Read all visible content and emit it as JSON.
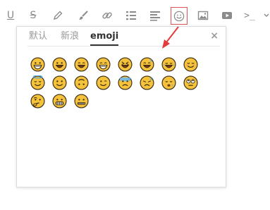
{
  "toolbar": {
    "buttons": [
      {
        "name": "underline",
        "icon": "underline-icon"
      },
      {
        "name": "strikethrough",
        "icon": "strikethrough-icon"
      },
      {
        "name": "pencil",
        "icon": "pencil-icon"
      },
      {
        "name": "brush",
        "icon": "brush-icon"
      },
      {
        "name": "link",
        "icon": "link-icon"
      },
      {
        "name": "list",
        "icon": "bullet-list-icon"
      },
      {
        "name": "align",
        "icon": "align-left-icon"
      },
      {
        "name": "emoji",
        "icon": "smiley-icon",
        "active": true
      },
      {
        "name": "image",
        "icon": "image-icon"
      },
      {
        "name": "video",
        "icon": "video-icon"
      },
      {
        "name": "code",
        "icon": "code-icon"
      },
      {
        "name": "more",
        "icon": "more-icon"
      }
    ],
    "underline_glyph": "U",
    "strike_glyph": "S",
    "code_glyph": ">_"
  },
  "emoji_panel": {
    "tabs": [
      {
        "label": "默认",
        "active": false
      },
      {
        "label": "新浪",
        "active": false
      },
      {
        "label": "emoji",
        "active": true
      }
    ],
    "close_glyph": "×",
    "emojis": [
      "grin",
      "smiley",
      "smile",
      "grinning",
      "laughing",
      "sweat-smile",
      "joy",
      "blush",
      "innocent",
      "slightly-smiling",
      "upside-down",
      "wink",
      "cold-sweat",
      "disappointed-relieved",
      "sleepy",
      "rolling-eyes",
      "thinking",
      "grimacing",
      "zipper-mouth"
    ]
  },
  "colors": {
    "accent_border": "#e05353",
    "arrow": "#e43b3b",
    "emoji_face": "#f5c33b",
    "emoji_outline": "#3a2a12",
    "icon_gray": "#8b8b8b"
  }
}
